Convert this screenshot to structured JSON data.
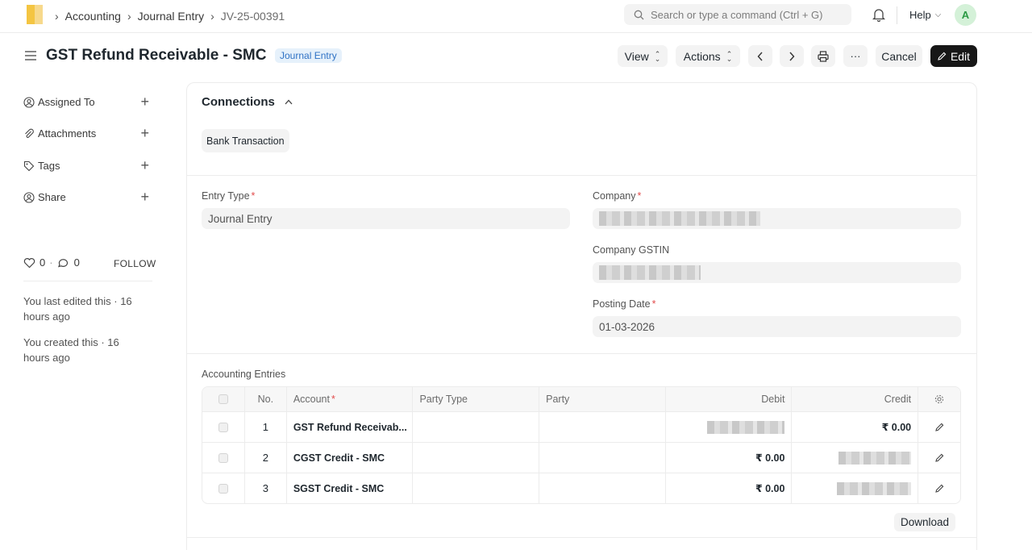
{
  "navbar": {
    "breadcrumbs": [
      "Accounting",
      "Journal Entry",
      "JV-25-00391"
    ],
    "search_placeholder": "Search or type a command (Ctrl + G)",
    "help_label": "Help",
    "avatar_initial": "A"
  },
  "page": {
    "title": "GST Refund Receivable - SMC",
    "doctype_badge": "Journal Entry",
    "buttons": {
      "view": "View",
      "actions": "Actions",
      "cancel": "Cancel",
      "edit": "Edit"
    }
  },
  "sidebar": {
    "items": [
      {
        "label": "Assigned To",
        "icon": "assign-icon"
      },
      {
        "label": "Attachments",
        "icon": "paperclip-icon"
      },
      {
        "label": "Tags",
        "icon": "tag-icon"
      },
      {
        "label": "Share",
        "icon": "share-icon"
      }
    ],
    "likes_count": "0",
    "comments_count": "0",
    "follow_label": "FOLLOW",
    "last_edited": "You last edited this · 16 hours ago",
    "created": "You created this · 16 hours ago"
  },
  "connections": {
    "title": "Connections",
    "items": [
      "Bank Transaction"
    ]
  },
  "form": {
    "entry_type_label": "Entry Type",
    "entry_type_value": "Journal Entry",
    "company_label": "Company",
    "company_gstin_label": "Company GSTIN",
    "posting_date_label": "Posting Date",
    "posting_date_value": "01-03-2026"
  },
  "accounting_entries": {
    "label": "Accounting Entries",
    "columns": [
      "No.",
      "Account",
      "Party Type",
      "Party",
      "Debit",
      "Credit"
    ],
    "rows": [
      {
        "no": "1",
        "account": "GST Refund Receivab...",
        "party_type": "",
        "party": "",
        "debit": "",
        "credit": "₹ 0.00"
      },
      {
        "no": "2",
        "account": "CGST Credit - SMC",
        "party_type": "",
        "party": "",
        "debit": "₹ 0.00",
        "credit": ""
      },
      {
        "no": "3",
        "account": "SGST Credit - SMC",
        "party_type": "",
        "party": "",
        "debit": "₹ 0.00",
        "credit": ""
      }
    ],
    "download_label": "Download"
  },
  "colors": {
    "primary_dark": "#171717",
    "badge_blue": "#2f72c5",
    "required_red": "#e24c4c",
    "avatar_green": "#2b9a44"
  }
}
